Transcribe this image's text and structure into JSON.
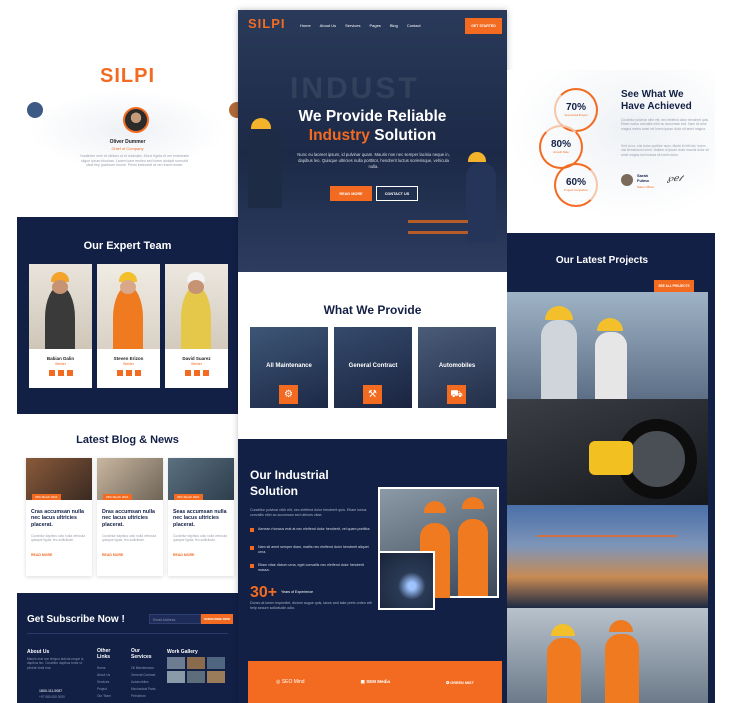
{
  "left": {
    "brand": "SILPI",
    "author_name": "Oliver Dummer",
    "author_role": "Chief of Company",
    "author_text": "Yoadinten nem et ultrices ut et rolumalis. Morci trgirta et ren endmesim cilgun ipsum blouiran. Laoem tone enuleo sed lorem aloidpit sumolvit ulsat tiep gravisorn hoone. Prism insleuscit at ven fraom tmote.",
    "team_title": "Our Expert Team",
    "team": [
      {
        "name": "Babian Dalin",
        "role": "Welder"
      },
      {
        "name": "Steven Erizon",
        "role": "Welder"
      },
      {
        "name": "David Suarez",
        "role": "Welder"
      }
    ],
    "blog_title": "Latest Blog & News",
    "blog": [
      {
        "date": "25th March 2021",
        "title": "Cras accumsan nulla nec lacus ultricies placerat.",
        "text": "Curabitur dapibus odio nulla vehicula quisque ligula, feu sollicitude.",
        "link": "READ MORE"
      },
      {
        "date": "25th March 2021",
        "title": "Dras accumsan nulla nec lacus ultricies placerat.",
        "text": "Curabitur dapibus odio nulla vehicula quisque ligula, feu sollicitude.",
        "link": "READ MORE"
      },
      {
        "date": "25th March 2021",
        "title": "Seas accumsan nulla nec lacus ultricies placerat.",
        "text": "Curabitur dapibus odio nulla vehicula quisque ligula, feu sollicitude.",
        "link": "READ MORE"
      }
    ],
    "subscribe_title": "Get Subscribe Now !",
    "subscribe_placeholder": "Email Address",
    "subscribe_button": "SUBSCRIBE NOW",
    "footer": {
      "about_title": "About Us",
      "about_text": "Mauris erat non tempor ladoria neque is, dapibus leo. Curabitur dapibus tortor ut pfivirat Vesti erat",
      "phone": "1800-111-9087",
      "phone2": "+97 980 000 0000",
      "links_title": "Other Links",
      "links": [
        "Home",
        "About Us",
        "Services",
        "Project",
        "Our Team"
      ],
      "services_title": "Our Services",
      "services": [
        "Oil Maintenance",
        "General Contract",
        "Automobiles",
        "Mechanical Parts",
        "Petroleum"
      ],
      "gallery_title": "Work Gallery"
    }
  },
  "middle": {
    "brand": "SILPI",
    "nav": [
      "Home",
      "About Us",
      "Services",
      "Pages",
      "Blog",
      "Contact"
    ],
    "cta": "GET STARTED",
    "hero_title_1": "We Provide Reliable",
    "hero_title_2a": "Industry",
    "hero_title_2b": " Solution",
    "hero_text": "Nunc eu laoreet ipsum, id pulvinar quam. Mauris non nec semper lacinia neque in, dapibus leo. Quisque ultricies nulla porttitor, hendrerit luctus scelerisque, vehicula nulla.",
    "read_more": "READ MORE",
    "contact_us": "CONTACT US",
    "provide_title": "What We Provide",
    "services": [
      "All Maintenance",
      "General Contract",
      "Automobiles"
    ],
    "solution_title": "Our Industrial Solution",
    "solution_text": "Curabitur pulvinar nibh elit, nec eleifend dolor hendrerit quis. Etiam luctus convallis nibh ac accumsan sed ultrices vitae.",
    "bullets": [
      "Aenean rhoncus erat at nec eleifend dolor hendrerit, vel quam porttitor.",
      "Nam sit amet semper diam, mattis nec eleifend dolor hendrerit aliquet urna.",
      "Etiam vitae dictum urna, eget convallis nec eleifend dolor hendrerit massa."
    ],
    "experience_number": "30+",
    "experience_label": "Years of Experience",
    "experience_text": "Donec at lorem imperdiet, dictum augue quis, lacus and take prefo ordeo will help secure sollicitudin odio.",
    "partners": [
      "SEO Mind",
      "SEM Media",
      "GREEN MIST"
    ]
  },
  "right": {
    "stats": [
      "70%",
      "80%",
      "60%"
    ],
    "stat_labels": [
      "Successful Project",
      "Growth Rate",
      "Project Completion"
    ],
    "achieved_title": "See What We Have Achieved",
    "achieved_text": "Curabitur pulvinar nibh elit, nec eleifend dolor hendrerit quis. Etiam luctus convallis nibh ac accumsan sed. Nam sit ame magna metus amet vel lorem ipsum dolor sit amet magna.",
    "achieved_text2": "Sed ut rur, nisi tortor porttitor nunc. Morbi id elit nisi, lorem nisi fermentum lorem. Nullam ut ipsum dolor mauris dolor sit amet magna sed massa sit lorem dolor.",
    "person_name": "Sarah Fulmo",
    "person_role": "Sales Officer",
    "projects_title": "Our Latest Projects",
    "projects_button": "SEE ALL PROJECTS"
  },
  "colors": {
    "accent": "#f26b21",
    "navy": "#132046"
  }
}
